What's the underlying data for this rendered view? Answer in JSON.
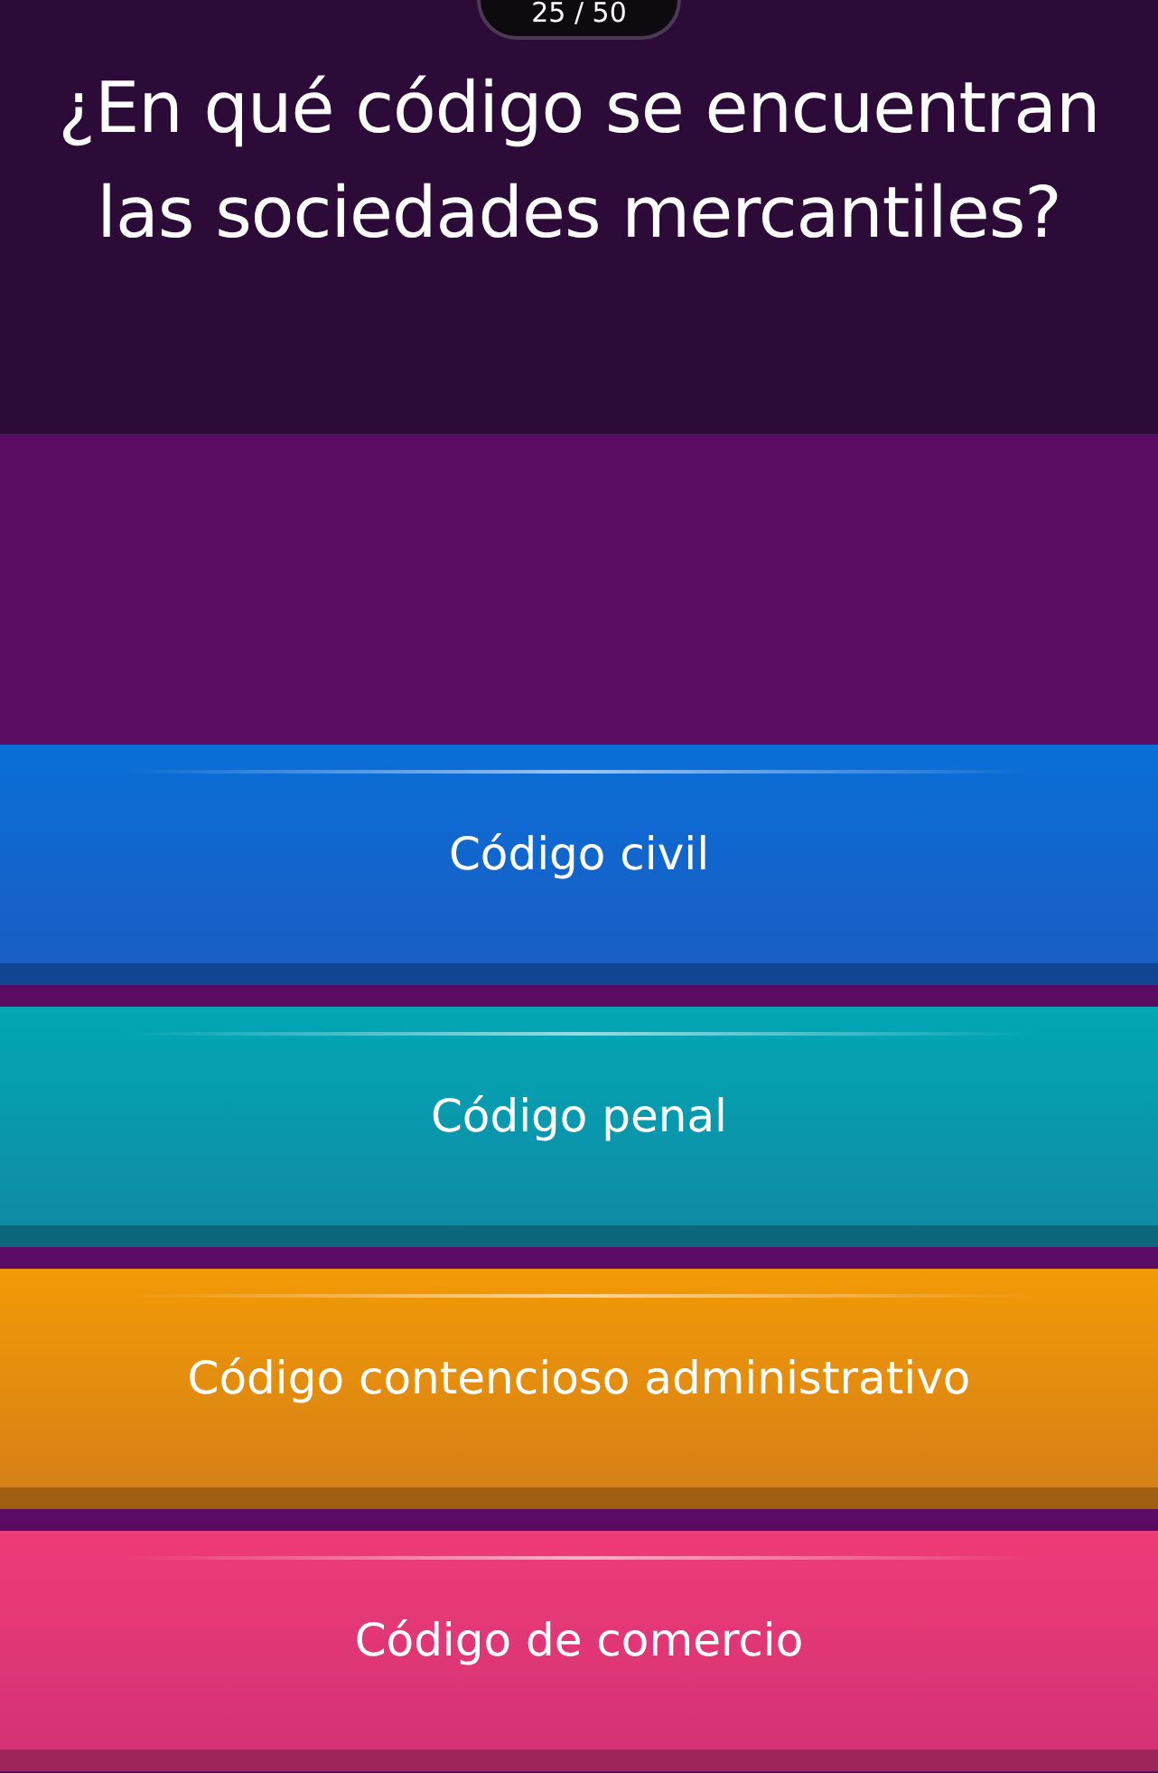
{
  "counter": "25 / 50",
  "question": "¿En qué código se encuentran las sociedades mercantiles?",
  "options": [
    {
      "label": "Código civil",
      "color": "#0a6fd8"
    },
    {
      "label": "Código penal",
      "color": "#00a7b5"
    },
    {
      "label": "Código contencioso administrativo",
      "color": "#f29a06"
    },
    {
      "label": "Código de comercio",
      "color": "#ef3b78"
    }
  ]
}
